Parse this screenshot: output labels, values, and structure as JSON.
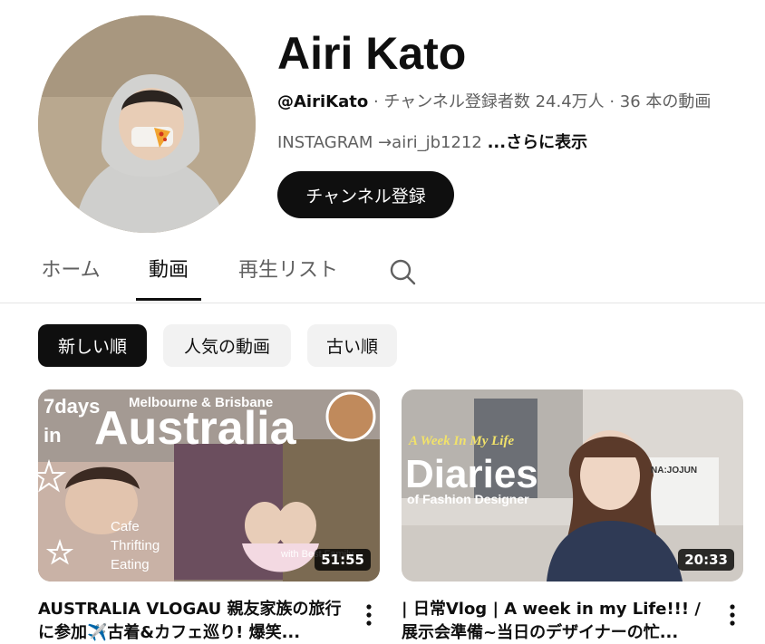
{
  "channel": {
    "name": "Airi Kato",
    "handle": "@AiriKato",
    "stats": " · チャンネル登録者数 24.4万人 · 36 本の動画",
    "description": "INSTAGRAM →airi_jb1212 ",
    "more_label": "...さらに表示",
    "subscribe_label": "チャンネル登録"
  },
  "tabs": [
    {
      "label": "ホーム",
      "active": false
    },
    {
      "label": "動画",
      "active": true
    },
    {
      "label": "再生リスト",
      "active": false
    }
  ],
  "search_icon": "search-icon",
  "chips": [
    {
      "label": "新しい順",
      "active": true
    },
    {
      "label": "人気の動画",
      "active": false
    },
    {
      "label": "古い順",
      "active": false
    }
  ],
  "videos": [
    {
      "title": "AUSTRALIA VLOGAU 親友家族の旅行に参加✈️古着&カフェ巡り! 爆笑...",
      "duration": "51:55",
      "thumb_text": {
        "days": "7days",
        "in": "in",
        "headline": "Australia",
        "top": "Melbourne & Brisbane",
        "list": [
          "Cafe",
          "Thrifting",
          "Eating"
        ],
        "corner": "with Best Family"
      }
    },
    {
      "title": "| 日常Vlog | A week in my Life!!! / 展示会準備~当日のデザイナーの忙...",
      "duration": "20:33",
      "thumb_text": {
        "tagline": "A Week In My Life",
        "headline": "Diaries",
        "sub": "of Fashion Designer",
        "sign": "NA:JOJUN"
      }
    }
  ],
  "colors": {
    "text": "#0f0f0f",
    "secondary": "#606060",
    "chip_bg": "#f2f2f2",
    "divider": "#e5e5e5"
  }
}
